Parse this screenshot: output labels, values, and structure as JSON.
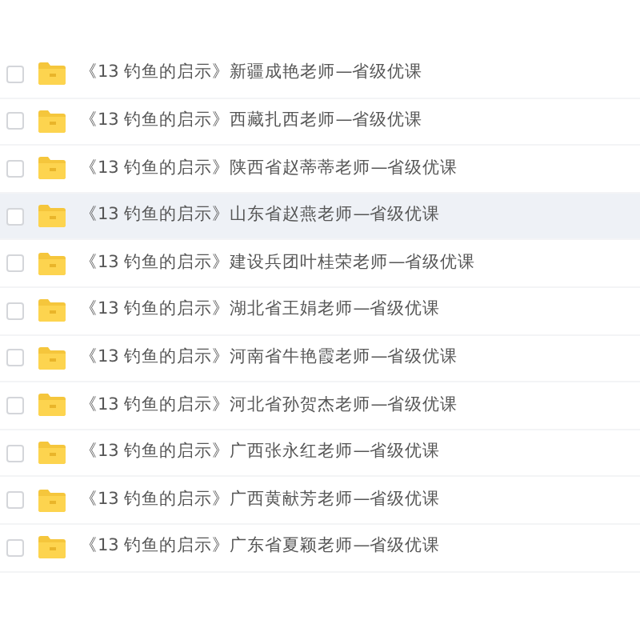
{
  "files": [
    {
      "name": "《13  钓鱼的启示》新疆成艳老师—省级优课",
      "checked": false,
      "highlighted": false
    },
    {
      "name": "《13  钓鱼的启示》西藏扎西老师—省级优课",
      "checked": false,
      "highlighted": false
    },
    {
      "name": "《13  钓鱼的启示》陕西省赵蒂蒂老师—省级优课",
      "checked": false,
      "highlighted": false
    },
    {
      "name": "《13  钓鱼的启示》山东省赵燕老师—省级优课",
      "checked": false,
      "highlighted": true
    },
    {
      "name": "《13  钓鱼的启示》建设兵团叶桂荣老师—省级优课",
      "checked": false,
      "highlighted": false
    },
    {
      "name": "《13  钓鱼的启示》湖北省王娟老师—省级优课",
      "checked": false,
      "highlighted": false
    },
    {
      "name": "《13  钓鱼的启示》河南省牛艳霞老师—省级优课",
      "checked": false,
      "highlighted": false
    },
    {
      "name": "《13  钓鱼的启示》河北省孙贺杰老师—省级优课",
      "checked": false,
      "highlighted": false
    },
    {
      "name": "《13  钓鱼的启示》广西张永红老师—省级优课",
      "checked": false,
      "highlighted": false
    },
    {
      "name": "《13  钓鱼的启示》广西黄献芳老师—省级优课",
      "checked": false,
      "highlighted": false
    },
    {
      "name": "《13  钓鱼的启示》广东省夏颖老师—省级优课",
      "checked": false,
      "highlighted": false
    }
  ]
}
